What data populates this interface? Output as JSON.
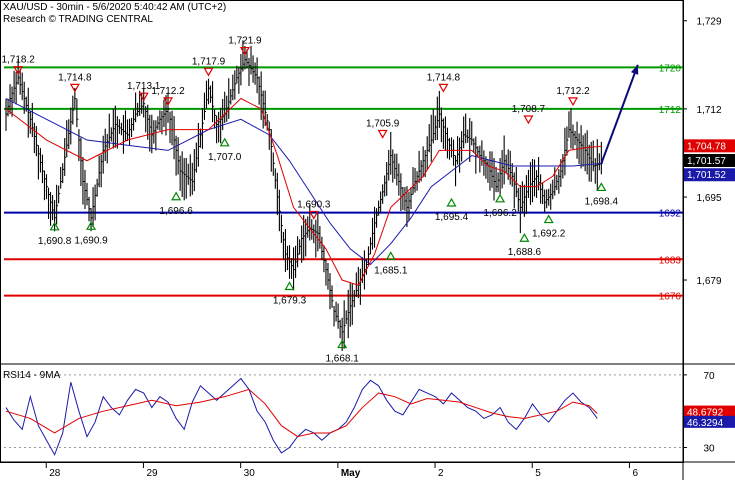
{
  "header": {
    "line1": "XAU/USD - 30min - 5/6/2020 5:40:42 AM (UTC+2)",
    "line2": "Research © TRADING CENTRAL"
  },
  "chart_data": [
    {
      "type": "line",
      "title": "XAU/USD - 30min - 5/6/2020 5:40:42 AM (UTC+2)",
      "subtitle": "Research © TRADING CENTRAL",
      "ylim": [
        1663,
        1733
      ],
      "y_ticks": [
        {
          "value": 1729,
          "label": "1,729"
        },
        {
          "value": 1712,
          "label": "1,712"
        },
        {
          "value": 1695,
          "label": "1,695"
        },
        {
          "value": 1679,
          "label": "1,679"
        }
      ],
      "x_ticks": [
        {
          "label": "28",
          "bar": 5
        },
        {
          "label": "29",
          "bar": 29
        },
        {
          "label": "30",
          "bar": 53
        },
        {
          "label": "May",
          "bar": 77,
          "bold": true
        },
        {
          "label": "2",
          "bar": 101
        },
        {
          "label": "5",
          "bar": 125
        },
        {
          "label": "6",
          "bar": 149
        }
      ],
      "price_path": [
        [
          0,
          1711
        ],
        [
          1,
          1714
        ],
        [
          3,
          1718
        ],
        [
          6,
          1710
        ],
        [
          9,
          1700
        ],
        [
          12,
          1691
        ],
        [
          15,
          1705
        ],
        [
          17,
          1714
        ],
        [
          19,
          1698
        ],
        [
          21,
          1691
        ],
        [
          24,
          1704
        ],
        [
          27,
          1709
        ],
        [
          30,
          1707
        ],
        [
          32,
          1711
        ],
        [
          34,
          1713
        ],
        [
          36,
          1707
        ],
        [
          38,
          1710
        ],
        [
          40,
          1712
        ],
        [
          43,
          1700
        ],
        [
          46,
          1698
        ],
        [
          48,
          1707
        ],
        [
          50,
          1716
        ],
        [
          52,
          1709
        ],
        [
          54,
          1711
        ],
        [
          57,
          1718
        ],
        [
          59,
          1721.5
        ],
        [
          62,
          1718
        ],
        [
          65,
          1708
        ],
        [
          67,
          1695
        ],
        [
          69,
          1684
        ],
        [
          71,
          1681
        ],
        [
          73,
          1687
        ],
        [
          75,
          1689
        ],
        [
          77,
          1688
        ],
        [
          79,
          1681
        ],
        [
          81,
          1673
        ],
        [
          83,
          1669
        ],
        [
          85,
          1674
        ],
        [
          87,
          1678
        ],
        [
          89,
          1682
        ],
        [
          91,
          1690
        ],
        [
          93,
          1696
        ],
        [
          95,
          1703
        ],
        [
          97,
          1698
        ],
        [
          99,
          1693
        ],
        [
          101,
          1698
        ],
        [
          103,
          1702
        ],
        [
          105,
          1706
        ],
        [
          107,
          1711
        ],
        [
          109,
          1706
        ],
        [
          111,
          1702
        ],
        [
          113,
          1707
        ],
        [
          115,
          1706
        ],
        [
          117,
          1703
        ],
        [
          119,
          1701
        ],
        [
          121,
          1697
        ],
        [
          123,
          1702
        ],
        [
          125,
          1699
        ],
        [
          127,
          1693
        ],
        [
          129,
          1697
        ],
        [
          131,
          1699
        ],
        [
          133,
          1694
        ],
        [
          135,
          1696
        ],
        [
          137,
          1700
        ],
        [
          139,
          1708
        ],
        [
          141,
          1706
        ],
        [
          143,
          1704
        ],
        [
          145,
          1701
        ],
        [
          147,
          1701.5
        ]
      ],
      "series": [
        {
          "name": "price",
          "color": "#000000",
          "last": "1,701.57"
        },
        {
          "name": "",
          "color": "#e00000",
          "last": "1,704.78"
        },
        {
          "name": "",
          "color": "#1a1aaa",
          "last": "1,701.52"
        }
      ],
      "red_ma_path": [
        [
          0,
          1712
        ],
        [
          10,
          1706
        ],
        [
          20,
          1702
        ],
        [
          30,
          1706
        ],
        [
          40,
          1708
        ],
        [
          50,
          1708
        ],
        [
          58,
          1714
        ],
        [
          63,
          1712
        ],
        [
          67,
          1703
        ],
        [
          71,
          1693
        ],
        [
          75,
          1689
        ],
        [
          79,
          1685
        ],
        [
          83,
          1679
        ],
        [
          87,
          1678
        ],
        [
          91,
          1684
        ],
        [
          95,
          1693
        ],
        [
          99,
          1696
        ],
        [
          103,
          1699
        ],
        [
          107,
          1704
        ],
        [
          111,
          1704
        ],
        [
          115,
          1704
        ],
        [
          119,
          1701
        ],
        [
          123,
          1700
        ],
        [
          127,
          1697
        ],
        [
          131,
          1697
        ],
        [
          135,
          1699
        ],
        [
          139,
          1704
        ],
        [
          143,
          1704.5
        ],
        [
          147,
          1704.8
        ]
      ],
      "blue_ma_path": [
        [
          0,
          1714
        ],
        [
          10,
          1710
        ],
        [
          20,
          1706
        ],
        [
          30,
          1705
        ],
        [
          40,
          1704
        ],
        [
          50,
          1708
        ],
        [
          58,
          1710
        ],
        [
          65,
          1707
        ],
        [
          70,
          1702
        ],
        [
          75,
          1696
        ],
        [
          80,
          1690
        ],
        [
          85,
          1685
        ],
        [
          90,
          1682
        ],
        [
          95,
          1686
        ],
        [
          100,
          1691
        ],
        [
          105,
          1697
        ],
        [
          110,
          1700
        ],
        [
          115,
          1703
        ],
        [
          120,
          1702
        ],
        [
          125,
          1701
        ],
        [
          130,
          1701
        ],
        [
          135,
          1701
        ],
        [
          140,
          1701
        ],
        [
          147,
          1701.5
        ]
      ],
      "horizontal_levels": [
        {
          "value": 1720,
          "label": "1720",
          "color": "#009900"
        },
        {
          "value": 1712,
          "label": "1712",
          "color": "#009900"
        },
        {
          "value": 1692,
          "label": "1692",
          "color": "#0000aa"
        },
        {
          "value": 1683,
          "label": "1683",
          "color": "#e00000"
        },
        {
          "value": 1676,
          "label": "1676",
          "color": "#e00000"
        }
      ],
      "projection": {
        "color": "#0a0a7a",
        "points": [
          [
            147,
            1701.5
          ],
          [
            152,
            1712
          ],
          [
            156,
            1720.5
          ]
        ]
      },
      "price_labels": [
        {
          "label": "1,718.2",
          "value": 1718.2,
          "bar": 3,
          "kind": "high"
        },
        {
          "label": "1,714.8",
          "value": 1714.8,
          "bar": 17,
          "kind": "high"
        },
        {
          "label": "1,713.1",
          "value": 1713.1,
          "bar": 34,
          "kind": "high"
        },
        {
          "label": "1,712.2",
          "value": 1712.2,
          "bar": 40,
          "kind": "high"
        },
        {
          "label": "1,717.9",
          "value": 1717.9,
          "bar": 50,
          "kind": "high"
        },
        {
          "label": "1,721.9",
          "value": 1721.9,
          "bar": 59,
          "kind": "high"
        },
        {
          "label": "1,707.0",
          "value": 1707.0,
          "bar": 54,
          "kind": "low"
        },
        {
          "label": "1,696.6",
          "value": 1696.6,
          "bar": 42,
          "kind": "low"
        },
        {
          "label": "1,690.8",
          "value": 1690.8,
          "bar": 12,
          "kind": "low"
        },
        {
          "label": "1,690.9",
          "value": 1690.9,
          "bar": 21,
          "kind": "low"
        },
        {
          "label": "1,690.3",
          "value": 1690.3,
          "bar": 76,
          "kind": "high"
        },
        {
          "label": "1,705.9",
          "value": 1705.9,
          "bar": 93,
          "kind": "high"
        },
        {
          "label": "1,679.3",
          "value": 1679.3,
          "bar": 70,
          "kind": "low"
        },
        {
          "label": "1,668.1",
          "value": 1668.1,
          "bar": 83,
          "kind": "low"
        },
        {
          "label": "1,685.1",
          "value": 1685.1,
          "bar": 95,
          "kind": "low"
        },
        {
          "label": "1,714.8",
          "value": 1714.8,
          "bar": 108,
          "kind": "high"
        },
        {
          "label": "1,695.4",
          "value": 1695.4,
          "bar": 110,
          "kind": "low"
        },
        {
          "label": "1,708.7",
          "value": 1708.7,
          "bar": 129,
          "kind": "high"
        },
        {
          "label": "1,696.2",
          "value": 1696.2,
          "bar": 122,
          "kind": "low"
        },
        {
          "label": "1,688.6",
          "value": 1688.6,
          "bar": 128,
          "kind": "low"
        },
        {
          "label": "1,692.2",
          "value": 1692.2,
          "bar": 134,
          "kind": "low"
        },
        {
          "label": "1,712.2",
          "value": 1712.2,
          "bar": 140,
          "kind": "high"
        },
        {
          "label": "1,698.4",
          "value": 1698.4,
          "bar": 147,
          "kind": "low"
        }
      ]
    },
    {
      "type": "line",
      "title": "RSI14 - 9MA",
      "ylim": [
        22,
        76
      ],
      "y_ticks": [
        {
          "value": 70,
          "label": "70"
        },
        {
          "value": 30,
          "label": "30"
        }
      ],
      "series": [
        {
          "name": "RSI14",
          "color": "#1a1aaa",
          "last": "46.3294"
        },
        {
          "name": "9MA",
          "color": "#e00000",
          "last": "48.6792"
        }
      ],
      "rsi_path": [
        [
          0,
          52
        ],
        [
          2,
          45
        ],
        [
          4,
          40
        ],
        [
          6,
          58
        ],
        [
          8,
          42
        ],
        [
          10,
          34
        ],
        [
          12,
          26
        ],
        [
          14,
          38
        ],
        [
          16,
          66
        ],
        [
          18,
          50
        ],
        [
          20,
          36
        ],
        [
          22,
          44
        ],
        [
          24,
          58
        ],
        [
          26,
          52
        ],
        [
          28,
          48
        ],
        [
          30,
          56
        ],
        [
          32,
          62
        ],
        [
          34,
          60
        ],
        [
          36,
          52
        ],
        [
          38,
          58
        ],
        [
          40,
          55
        ],
        [
          42,
          46
        ],
        [
          44,
          40
        ],
        [
          46,
          55
        ],
        [
          48,
          64
        ],
        [
          50,
          60
        ],
        [
          52,
          56
        ],
        [
          54,
          60
        ],
        [
          56,
          64
        ],
        [
          58,
          68
        ],
        [
          60,
          62
        ],
        [
          62,
          50
        ],
        [
          64,
          44
        ],
        [
          66,
          34
        ],
        [
          68,
          27
        ],
        [
          70,
          30
        ],
        [
          72,
          36
        ],
        [
          74,
          40
        ],
        [
          76,
          38
        ],
        [
          78,
          34
        ],
        [
          80,
          38
        ],
        [
          82,
          40
        ],
        [
          84,
          44
        ],
        [
          86,
          52
        ],
        [
          88,
          62
        ],
        [
          90,
          67
        ],
        [
          92,
          64
        ],
        [
          94,
          56
        ],
        [
          96,
          50
        ],
        [
          98,
          48
        ],
        [
          100,
          55
        ],
        [
          102,
          62
        ],
        [
          104,
          60
        ],
        [
          106,
          58
        ],
        [
          108,
          54
        ],
        [
          110,
          60
        ],
        [
          112,
          56
        ],
        [
          114,
          52
        ],
        [
          116,
          50
        ],
        [
          118,
          46
        ],
        [
          120,
          48
        ],
        [
          122,
          52
        ],
        [
          124,
          44
        ],
        [
          126,
          40
        ],
        [
          128,
          46
        ],
        [
          130,
          54
        ],
        [
          132,
          48
        ],
        [
          134,
          44
        ],
        [
          136,
          50
        ],
        [
          138,
          56
        ],
        [
          140,
          60
        ],
        [
          142,
          55
        ],
        [
          144,
          52
        ],
        [
          146,
          46
        ]
      ],
      "ma_path": [
        [
          0,
          50
        ],
        [
          6,
          46
        ],
        [
          12,
          38
        ],
        [
          18,
          46
        ],
        [
          24,
          50
        ],
        [
          30,
          53
        ],
        [
          36,
          56
        ],
        [
          42,
          53
        ],
        [
          48,
          55
        ],
        [
          54,
          58
        ],
        [
          60,
          62
        ],
        [
          64,
          54
        ],
        [
          68,
          42
        ],
        [
          72,
          36
        ],
        [
          76,
          38
        ],
        [
          80,
          38
        ],
        [
          84,
          42
        ],
        [
          88,
          52
        ],
        [
          92,
          60
        ],
        [
          96,
          58
        ],
        [
          100,
          54
        ],
        [
          104,
          57
        ],
        [
          108,
          56
        ],
        [
          112,
          55
        ],
        [
          116,
          52
        ],
        [
          120,
          49
        ],
        [
          124,
          47
        ],
        [
          128,
          46
        ],
        [
          132,
          48
        ],
        [
          136,
          50
        ],
        [
          140,
          55
        ],
        [
          144,
          53
        ],
        [
          146,
          48.7
        ]
      ]
    }
  ]
}
